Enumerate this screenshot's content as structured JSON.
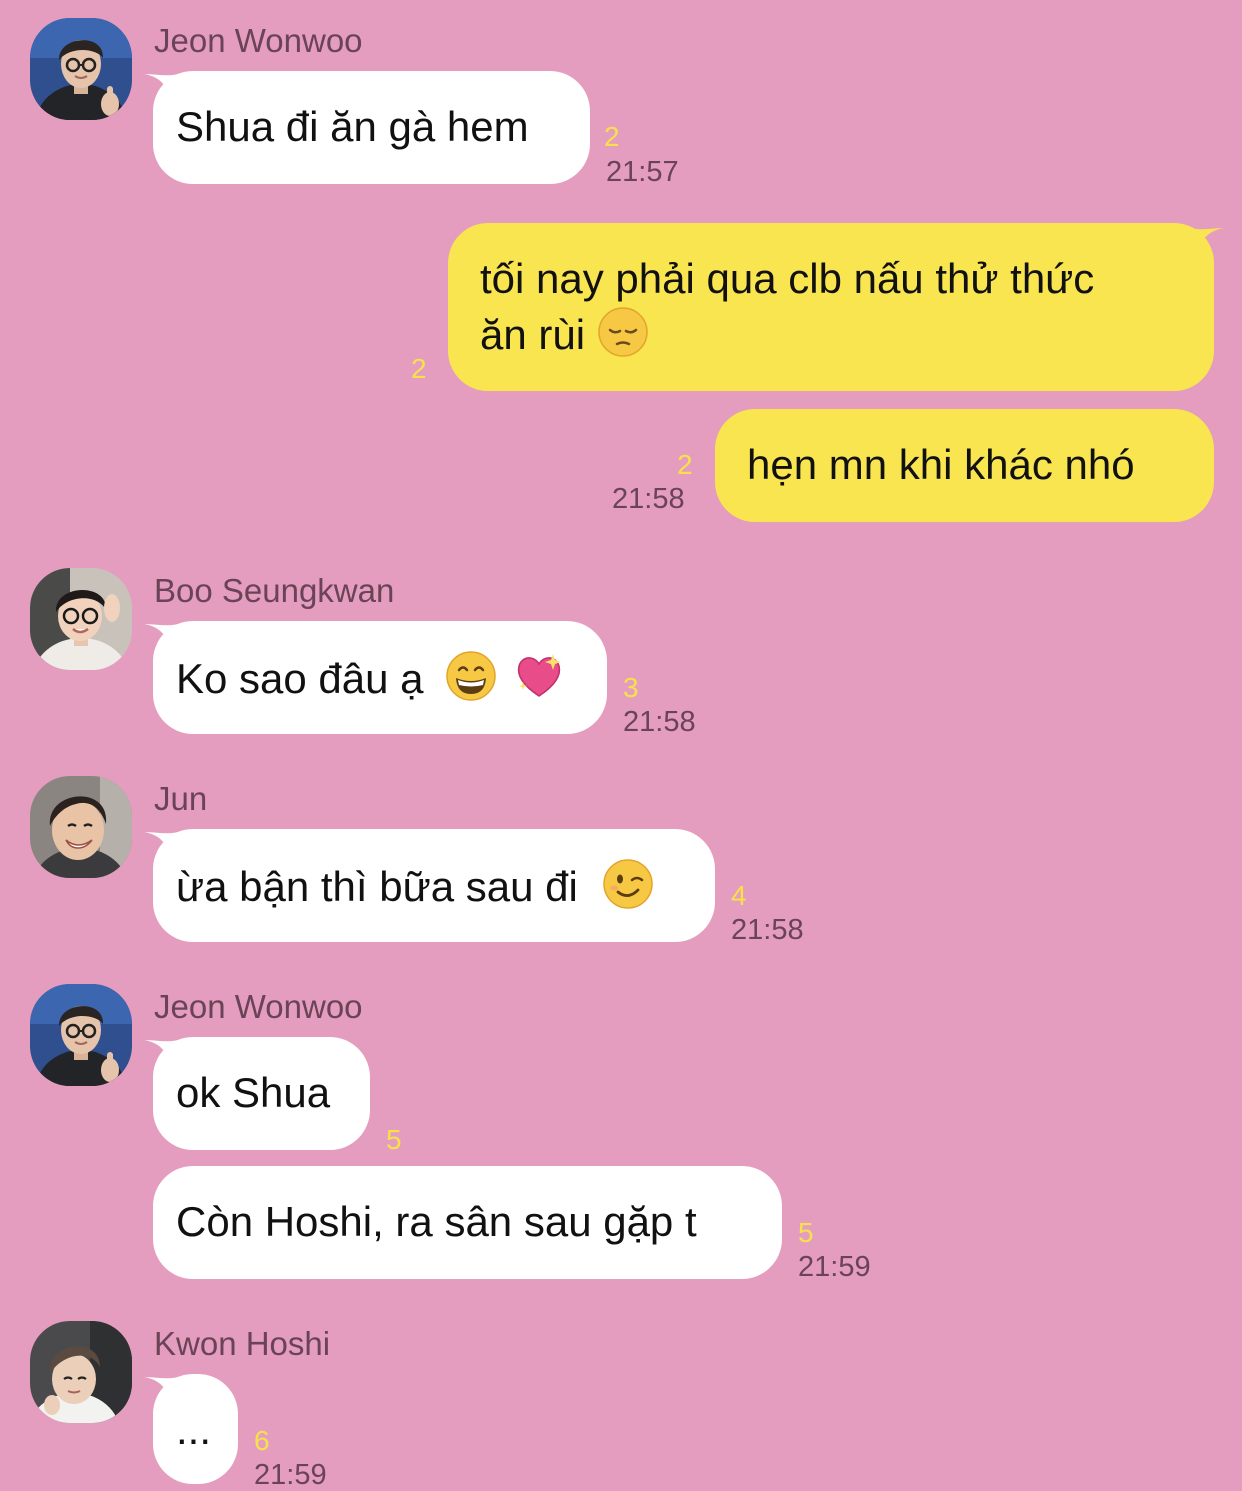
{
  "colors": {
    "background": "#e49dbe",
    "incoming_bubble": "#ffffff",
    "outgoing_bubble": "#f9e550",
    "unread_count": "#f7e14a",
    "name_and_time": "#6a4456"
  },
  "messages": [
    {
      "sender": "Jeon Wonwoo",
      "text": "Shua đi ăn gà hem",
      "unread": "2",
      "time": "21:57"
    },
    {
      "sender": "me",
      "line1": "tối nay phải qua clb nấu thử thức",
      "line2": "ăn rùi",
      "emoji": "pensive-face-icon",
      "unread": "2"
    },
    {
      "sender": "me",
      "text": "hẹn mn khi khác nhó",
      "unread": "2",
      "time": "21:58"
    },
    {
      "sender": "Boo Seungkwan",
      "text": "Ko sao đâu ạ",
      "emoji": [
        "grinning-face-icon",
        "sparkling-heart-icon"
      ],
      "unread": "3",
      "time": "21:58"
    },
    {
      "sender": "Jun",
      "text": "ừa bận thì bữa sau đi",
      "emoji": "winking-face-icon",
      "unread": "4",
      "time": "21:58"
    },
    {
      "sender": "Jeon Wonwoo",
      "text": "ok Shua",
      "unread": "5"
    },
    {
      "sender": "Jeon Wonwoo",
      "text": "Còn Hoshi, ra sân sau gặp t",
      "unread": "5",
      "time": "21:59"
    },
    {
      "sender": "Kwon Hoshi",
      "text": "...",
      "unread": "6",
      "time": "21:59"
    }
  ]
}
